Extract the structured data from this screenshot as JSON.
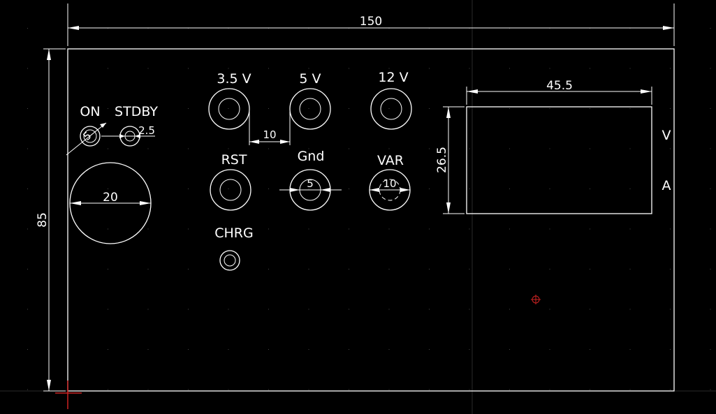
{
  "drawing": {
    "dimensions": {
      "overall_width": "150",
      "overall_height": "85",
      "display_width": "45.5",
      "display_height": "26.5",
      "jack_spacing": "10",
      "led_on_dia": "5",
      "led_stdby_dia": "2.5",
      "knob_dia": "20",
      "jack_gnd_dia": "5",
      "jack_var_dia": "10"
    },
    "labels": {
      "on": "ON",
      "stdby": "STDBY",
      "v35": "3.5 V",
      "v5": "5 V",
      "v12": "12 V",
      "rst": "RST",
      "gnd": "Gnd",
      "var": "VAR",
      "chrg": "CHRG",
      "volt": "V",
      "amp": "A"
    },
    "colors": {
      "background": "#000000",
      "lines": "#ffffff",
      "cursor": "#cc2222",
      "snap_marker": "#cc2222"
    }
  }
}
